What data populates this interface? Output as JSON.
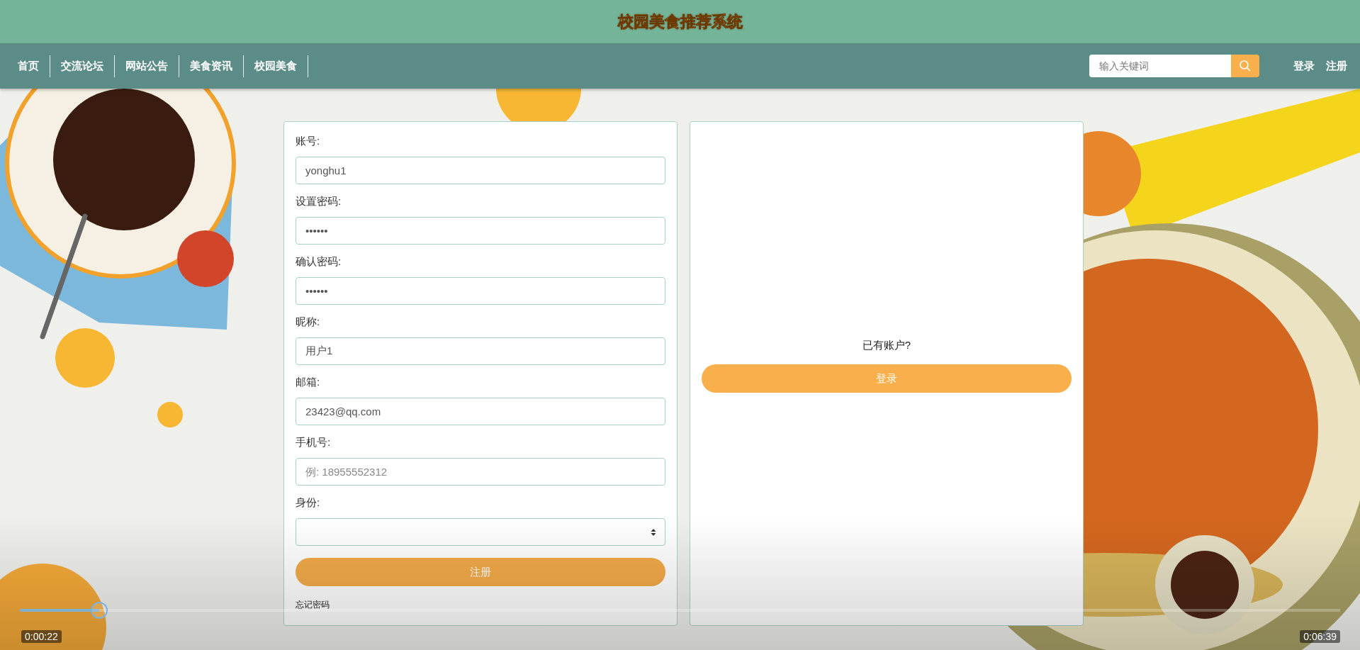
{
  "header": {
    "title": "校园美食推荐系统"
  },
  "nav": {
    "items": [
      {
        "label": "首页"
      },
      {
        "label": "交流论坛"
      },
      {
        "label": "网站公告"
      },
      {
        "label": "美食资讯"
      },
      {
        "label": "校园美食"
      }
    ],
    "search": {
      "placeholder": "输入关键词"
    },
    "auth_links": [
      "登录",
      "注册"
    ]
  },
  "register_form": {
    "fields": [
      {
        "kind": "text",
        "label": "账号:",
        "value": "yonghu1"
      },
      {
        "kind": "password",
        "label": "设置密码:",
        "value": "••••••"
      },
      {
        "kind": "password",
        "label": "确认密码:",
        "value": "••••••"
      },
      {
        "kind": "text",
        "label": "昵称:",
        "value": "用户1"
      },
      {
        "kind": "text",
        "label": "邮箱:",
        "value": "23423@qq.com"
      },
      {
        "kind": "text",
        "label": "手机号:",
        "placeholder": "例: 18955552312"
      },
      {
        "kind": "select",
        "label": "身份:"
      }
    ],
    "submit": "注册",
    "forgot_link": "忘记密码"
  },
  "login_panel": {
    "prompt": "已有账户?",
    "button": "登录"
  },
  "video_player": {
    "current_time": "0:00:22",
    "duration": "0:06:39",
    "level": 0.06
  }
}
